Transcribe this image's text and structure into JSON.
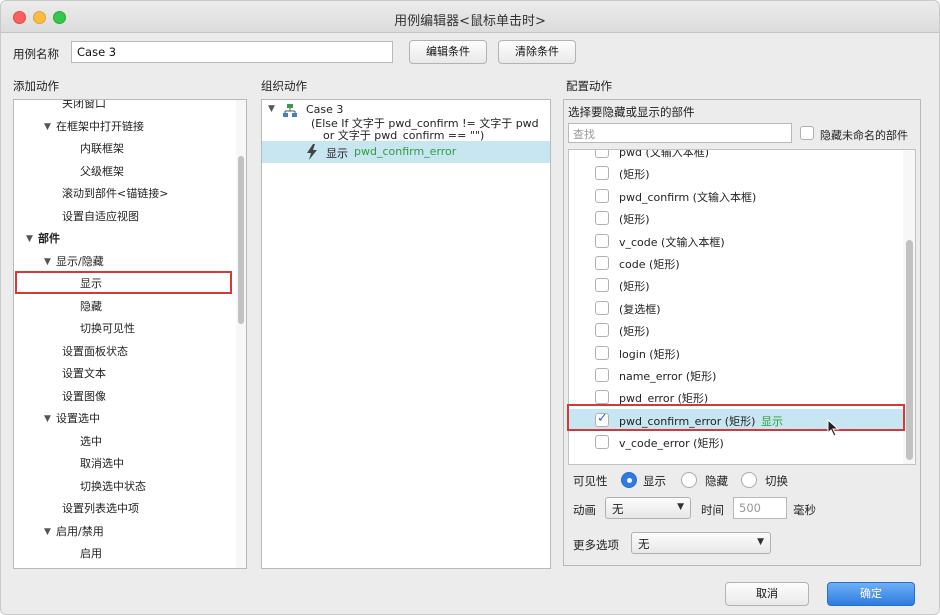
{
  "window": {
    "title": "用例编辑器<鼠标单击时>"
  },
  "case_name": {
    "label": "用例名称",
    "value": "Case 3"
  },
  "buttons": {
    "edit_condition": "编辑条件",
    "clear_condition": "清除条件",
    "cancel": "取消",
    "ok": "确定"
  },
  "sections": {
    "add_action": "添加动作",
    "organize_action": "组织动作",
    "configure_action": "配置动作"
  },
  "add_action_tree": [
    {
      "label": "关闭窗口",
      "level": 2,
      "toggle": ""
    },
    {
      "label": "在框架中打开链接",
      "level": 1,
      "toggle": "▼"
    },
    {
      "label": "内联框架",
      "level": 3,
      "toggle": ""
    },
    {
      "label": "父级框架",
      "level": 3,
      "toggle": ""
    },
    {
      "label": "滚动到部件<锚链接>",
      "level": 2,
      "toggle": ""
    },
    {
      "label": "设置自适应视图",
      "level": 2,
      "toggle": ""
    },
    {
      "label": "部件",
      "level": 0,
      "toggle": "▼"
    },
    {
      "label": "显示/隐藏",
      "level": 1,
      "toggle": "▼"
    },
    {
      "label": "显示",
      "level": 3,
      "toggle": ""
    },
    {
      "label": "隐藏",
      "level": 3,
      "toggle": ""
    },
    {
      "label": "切换可见性",
      "level": 3,
      "toggle": ""
    },
    {
      "label": "设置面板状态",
      "level": 2,
      "toggle": ""
    },
    {
      "label": "设置文本",
      "level": 2,
      "toggle": ""
    },
    {
      "label": "设置图像",
      "level": 2,
      "toggle": ""
    },
    {
      "label": "设置选中",
      "level": 1,
      "toggle": "▼"
    },
    {
      "label": "选中",
      "level": 3,
      "toggle": ""
    },
    {
      "label": "取消选中",
      "level": 3,
      "toggle": ""
    },
    {
      "label": "切换选中状态",
      "level": 3,
      "toggle": ""
    },
    {
      "label": "设置列表选中项",
      "level": 2,
      "toggle": ""
    },
    {
      "label": "启用/禁用",
      "level": 1,
      "toggle": "▼"
    },
    {
      "label": "启用",
      "level": 3,
      "toggle": ""
    }
  ],
  "organize": {
    "case_title": "Case 3",
    "condition_line1": "(Else If 文字于 pwd_confirm != 文字于 pwd",
    "condition_line2": "or 文字于 pwd_confirm == \"\")",
    "action_verb": "显示",
    "action_target": "pwd_confirm_error"
  },
  "configure": {
    "choose_label": "选择要隐藏或显示的部件",
    "search_placeholder": "查找",
    "hide_unnamed_label": "隐藏未命名的部件",
    "widgets": [
      {
        "label": "pwd (文输入本框)",
        "checked": false,
        "suffix": ""
      },
      {
        "label": "(矩形)",
        "checked": false,
        "suffix": ""
      },
      {
        "label": "pwd_confirm (文输入本框)",
        "checked": false,
        "suffix": ""
      },
      {
        "label": "(矩形)",
        "checked": false,
        "suffix": ""
      },
      {
        "label": "v_code (文输入本框)",
        "checked": false,
        "suffix": ""
      },
      {
        "label": "code (矩形)",
        "checked": false,
        "suffix": ""
      },
      {
        "label": "(矩形)",
        "checked": false,
        "suffix": ""
      },
      {
        "label": "(复选框)",
        "checked": false,
        "suffix": ""
      },
      {
        "label": "(矩形)",
        "checked": false,
        "suffix": ""
      },
      {
        "label": "login (矩形)",
        "checked": false,
        "suffix": ""
      },
      {
        "label": "name_error (矩形)",
        "checked": false,
        "suffix": ""
      },
      {
        "label": "pwd_error (矩形)",
        "checked": false,
        "suffix": ""
      },
      {
        "label": "pwd_confirm_error (矩形)",
        "checked": true,
        "suffix": "显示"
      },
      {
        "label": "v_code_error (矩形)",
        "checked": false,
        "suffix": ""
      }
    ],
    "visibility_label": "可见性",
    "visibility_options": [
      "显示",
      "隐藏",
      "切换"
    ],
    "animation_label": "动画",
    "animation_value": "无",
    "time_label": "时间",
    "time_value": "500",
    "time_unit": "毫秒",
    "more_label": "更多选项",
    "more_value": "无"
  },
  "colors": {
    "accent": "#2f7ce0",
    "selection": "#c7e6f2",
    "action_green": "#2e9d3a",
    "highlight_red": "#d23a3a"
  }
}
